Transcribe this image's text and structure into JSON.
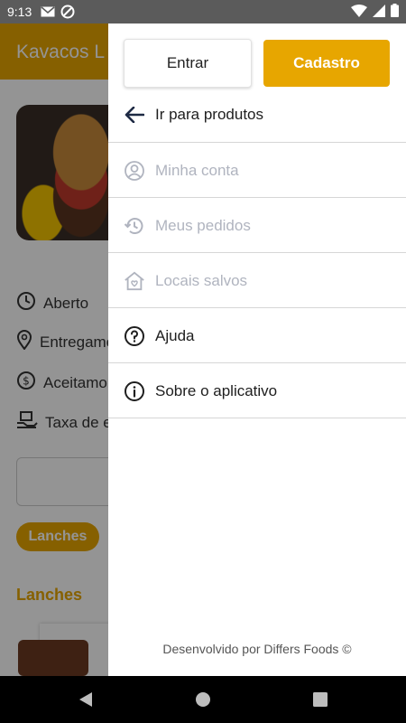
{
  "status_bar": {
    "time": "9:13"
  },
  "background": {
    "title": "Kavacos L",
    "info": [
      "Aberto",
      "Entregamo",
      "Aceitamo",
      "Taxa de e"
    ],
    "chip": "Lanches",
    "section": "Lanches"
  },
  "drawer": {
    "login_label": "Entrar",
    "signup_label": "Cadastro",
    "menu": [
      {
        "label": "Ir para produtos",
        "icon": "arrow-left-icon",
        "enabled": true
      },
      {
        "label": "Minha conta",
        "icon": "account-circle-icon",
        "enabled": false
      },
      {
        "label": "Meus pedidos",
        "icon": "history-icon",
        "enabled": false
      },
      {
        "label": "Locais salvos",
        "icon": "home-heart-icon",
        "enabled": false
      },
      {
        "label": "Ajuda",
        "icon": "help-circle-icon",
        "enabled": true
      },
      {
        "label": "Sobre o aplicativo",
        "icon": "info-circle-icon",
        "enabled": true
      }
    ],
    "footer": "Desenvolvido por Differs Foods ©"
  },
  "colors": {
    "accent": "#e7a600",
    "muted_text": "#b0b4bf",
    "dark_text": "#1e1e1e"
  }
}
